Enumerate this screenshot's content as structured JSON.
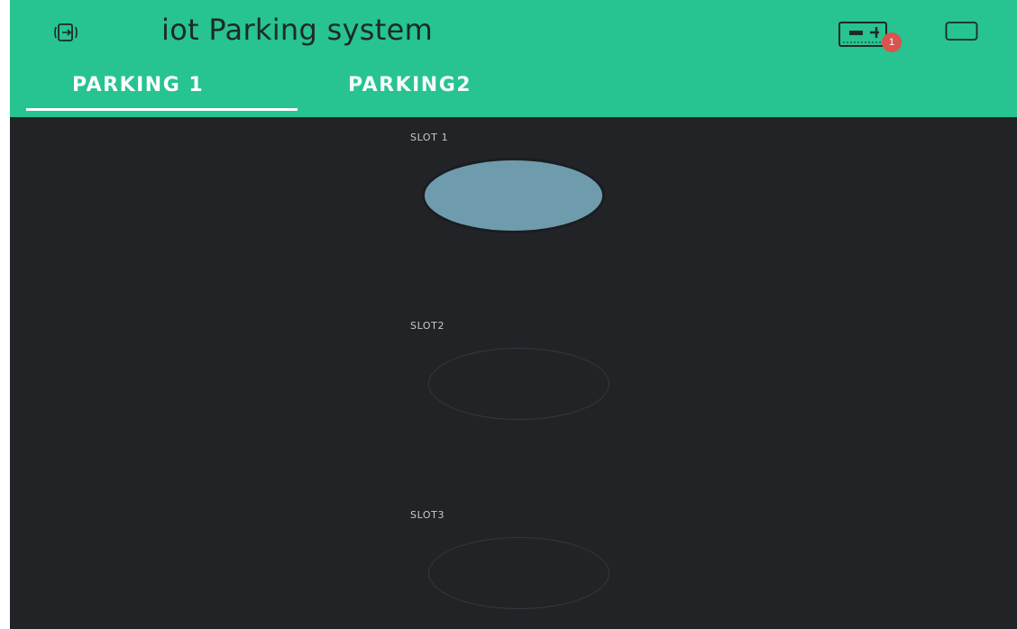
{
  "app": {
    "title": "iot Parking system",
    "notification_count": "1"
  },
  "icons": {
    "left": "screen-share-icon",
    "device": "hardware-device-icon",
    "window": "window-icon"
  },
  "tabs": [
    {
      "label": "PARKING 1",
      "active": true
    },
    {
      "label": "PARKING2",
      "active": false
    }
  ],
  "slots": [
    {
      "label": "SLOT 1",
      "led_on": true
    },
    {
      "label": "SLOT2",
      "led_on": false
    },
    {
      "label": "SLOT3",
      "led_on": false
    }
  ],
  "colors": {
    "header": "#27c391",
    "background": "#222326",
    "led_on": "#6f9cad",
    "badge": "#d9534f"
  }
}
